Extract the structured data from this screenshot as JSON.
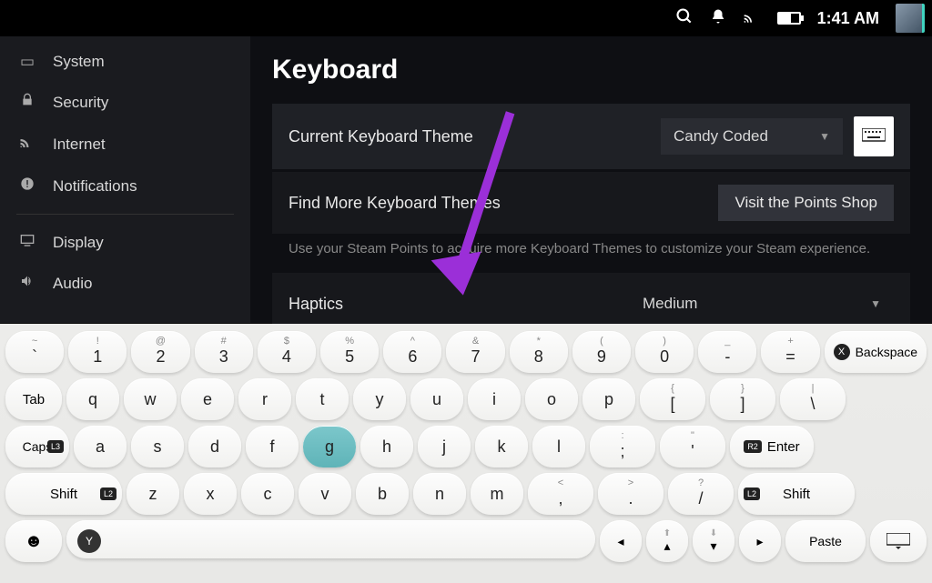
{
  "topbar": {
    "time": "1:41 AM"
  },
  "sidebar": {
    "items": [
      {
        "label": "System"
      },
      {
        "label": "Security"
      },
      {
        "label": "Internet"
      },
      {
        "label": "Notifications"
      },
      {
        "label": "Display"
      },
      {
        "label": "Audio"
      }
    ]
  },
  "page": {
    "title": "Keyboard",
    "theme_label": "Current Keyboard Theme",
    "theme_value": "Candy Coded",
    "more_label": "Find More Keyboard Themes",
    "shop_label": "Visit the Points Shop",
    "desc": "Use your Steam Points to acquire more Keyboard Themes to customize your Steam experience.",
    "haptics_label": "Haptics",
    "haptics_value": "Medium"
  },
  "keys": {
    "row1": [
      {
        "u": "~",
        "d": "`"
      },
      {
        "u": "!",
        "d": "1"
      },
      {
        "u": "@",
        "d": "2"
      },
      {
        "u": "#",
        "d": "3"
      },
      {
        "u": "$",
        "d": "4"
      },
      {
        "u": "%",
        "d": "5"
      },
      {
        "u": "^",
        "d": "6"
      },
      {
        "u": "&",
        "d": "7"
      },
      {
        "u": "*",
        "d": "8"
      },
      {
        "u": "(",
        "d": "9"
      },
      {
        "u": ")",
        "d": "0"
      },
      {
        "u": "_",
        "d": "-"
      },
      {
        "u": "+",
        "d": "="
      }
    ],
    "backspace": "Backspace",
    "tab": "Tab",
    "row2": [
      "q",
      "w",
      "e",
      "r",
      "t",
      "y",
      "u",
      "i",
      "o",
      "p"
    ],
    "row2b": [
      {
        "u": "{",
        "d": "["
      },
      {
        "u": "}",
        "d": "]"
      },
      {
        "u": "|",
        "d": "\\"
      }
    ],
    "caps": "Caps",
    "caps_badge": "L3",
    "row3": [
      "a",
      "s",
      "d",
      "f",
      "g",
      "h",
      "j",
      "k",
      "l"
    ],
    "row3b": [
      {
        "u": ":",
        "d": ";"
      },
      {
        "u": "\"",
        "d": "'"
      }
    ],
    "enter": "Enter",
    "enter_badge": "R2",
    "shift": "Shift",
    "shift_badge": "L2",
    "row4": [
      "z",
      "x",
      "c",
      "v",
      "b",
      "n",
      "m"
    ],
    "row4b": [
      {
        "u": "<",
        "d": ","
      },
      {
        "u": ">",
        "d": "."
      },
      {
        "u": "?",
        "d": "/"
      }
    ],
    "paste": "Paste",
    "y_badge": "Y",
    "arrows": [
      "◂",
      "▴",
      "▾",
      "▸"
    ]
  }
}
